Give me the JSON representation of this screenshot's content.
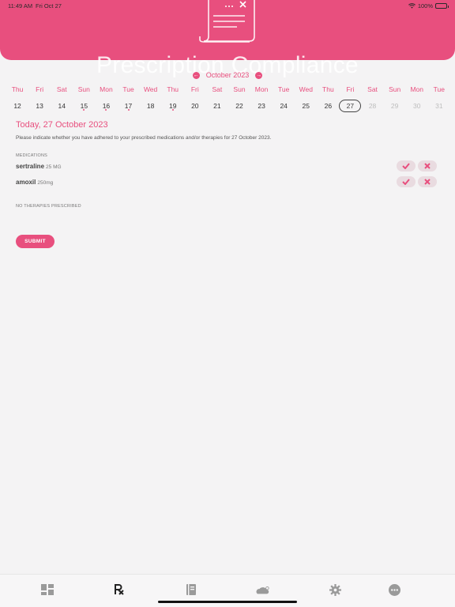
{
  "status_bar": {
    "time": "11:49 AM",
    "date": "Fri Oct 27",
    "battery": "100%"
  },
  "header": {
    "title": "Prescription Compliance"
  },
  "calendar": {
    "month_label": "October 2023",
    "days": [
      {
        "dow": "Thu",
        "num": "12",
        "dot": false,
        "future": false,
        "selected": false
      },
      {
        "dow": "Fri",
        "num": "13",
        "dot": false,
        "future": false,
        "selected": false
      },
      {
        "dow": "Sat",
        "num": "14",
        "dot": false,
        "future": false,
        "selected": false
      },
      {
        "dow": "Sun",
        "num": "15",
        "dot": true,
        "future": false,
        "selected": false
      },
      {
        "dow": "Mon",
        "num": "16",
        "dot": true,
        "future": false,
        "selected": false
      },
      {
        "dow": "Tue",
        "num": "17",
        "dot": true,
        "future": false,
        "selected": false
      },
      {
        "dow": "Wed",
        "num": "18",
        "dot": false,
        "future": false,
        "selected": false
      },
      {
        "dow": "Thu",
        "num": "19",
        "dot": true,
        "future": false,
        "selected": false
      },
      {
        "dow": "Fri",
        "num": "20",
        "dot": false,
        "future": false,
        "selected": false
      },
      {
        "dow": "Sat",
        "num": "21",
        "dot": false,
        "future": false,
        "selected": false
      },
      {
        "dow": "Sun",
        "num": "22",
        "dot": false,
        "future": false,
        "selected": false
      },
      {
        "dow": "Mon",
        "num": "23",
        "dot": false,
        "future": false,
        "selected": false
      },
      {
        "dow": "Tue",
        "num": "24",
        "dot": false,
        "future": false,
        "selected": false
      },
      {
        "dow": "Wed",
        "num": "25",
        "dot": false,
        "future": false,
        "selected": false
      },
      {
        "dow": "Thu",
        "num": "26",
        "dot": false,
        "future": false,
        "selected": false
      },
      {
        "dow": "Fri",
        "num": "27",
        "dot": false,
        "future": false,
        "selected": true
      },
      {
        "dow": "Sat",
        "num": "28",
        "dot": false,
        "future": true,
        "selected": false
      },
      {
        "dow": "Sun",
        "num": "29",
        "dot": false,
        "future": true,
        "selected": false
      },
      {
        "dow": "Mon",
        "num": "30",
        "dot": false,
        "future": true,
        "selected": false
      },
      {
        "dow": "Tue",
        "num": "31",
        "dot": false,
        "future": true,
        "selected": false
      }
    ]
  },
  "content": {
    "today_heading": "Today, 27 October 2023",
    "instructions": "Please indicate whether you have adhered to your prescribed medications and/or therapies for 27 October 2023.",
    "medications_label": "MEDICATIONS",
    "medications": [
      {
        "name": "sertraline",
        "dose": "25 MG"
      },
      {
        "name": "amoxil",
        "dose": "250mg"
      }
    ],
    "therapies_label": "NO THERAPIES PRESCRIBED",
    "submit_label": "SUBMIT"
  },
  "tabbar": {
    "tabs": [
      {
        "icon": "dashboard-icon"
      },
      {
        "icon": "prescription-icon",
        "active": true
      },
      {
        "icon": "journal-icon"
      },
      {
        "icon": "weather-icon"
      },
      {
        "icon": "settings-icon"
      },
      {
        "icon": "more-icon"
      }
    ]
  },
  "colors": {
    "accent": "#e84f7e",
    "background": "#f4f3f4",
    "button_bg": "#e9dbe0"
  }
}
